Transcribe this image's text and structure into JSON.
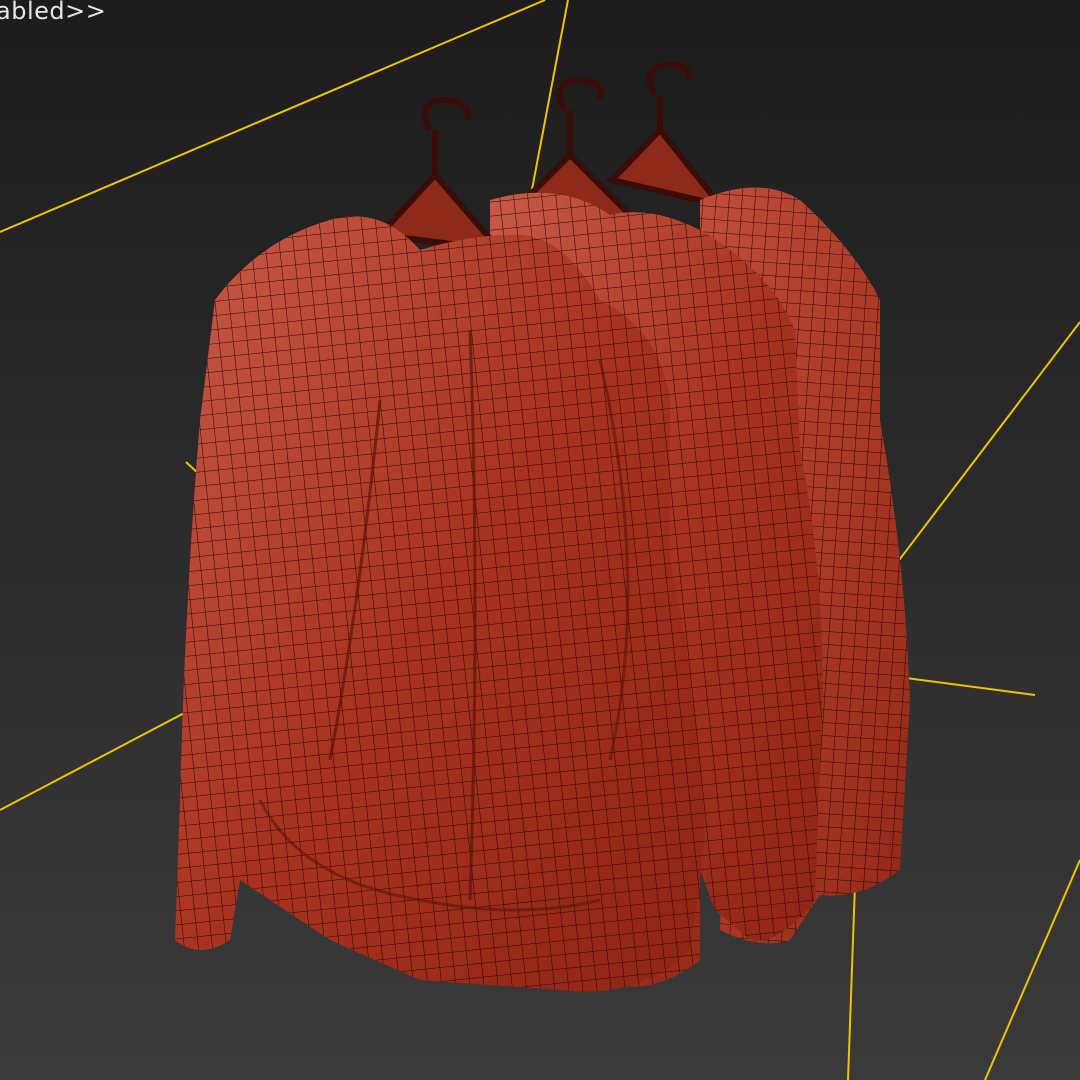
{
  "viewport": {
    "label": "abled>>",
    "background_top": "#1c1c1c",
    "background_bottom": "#3a3a3a",
    "bounding_box_color": "#f2c200"
  },
  "scene": {
    "objects": [
      {
        "name": "hoodie-front",
        "hanger": true,
        "color": "#b23a2a"
      },
      {
        "name": "hoodie-middle",
        "hanger": true,
        "color": "#b23a2a"
      },
      {
        "name": "hoodie-back",
        "hanger": true,
        "color": "#b23a2a"
      }
    ],
    "display_mode": "wireframe-on-shaded"
  }
}
